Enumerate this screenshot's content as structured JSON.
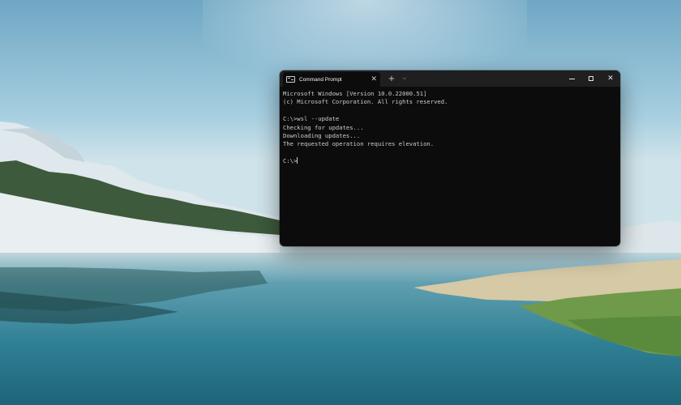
{
  "window": {
    "tab_title": "Command Prompt",
    "tab_icon": "terminal-icon",
    "buttons": {
      "new_tab": "+",
      "dropdown": "⌵",
      "tab_close": "✕",
      "close": "✕"
    }
  },
  "console": {
    "lines": [
      "Microsoft Windows [Version 10.0.22000.51]",
      "(c) Microsoft Corporation. All rights reserved.",
      "",
      "C:\\>wsl --update",
      "Checking for updates...",
      "Downloading updates...",
      "The requested operation requires elevation.",
      ""
    ],
    "prompt": "C:\\>"
  },
  "colors": {
    "console_bg": "#0c0c0c",
    "titlebar_bg": "#1f1f1f",
    "console_text": "#cccccc"
  }
}
